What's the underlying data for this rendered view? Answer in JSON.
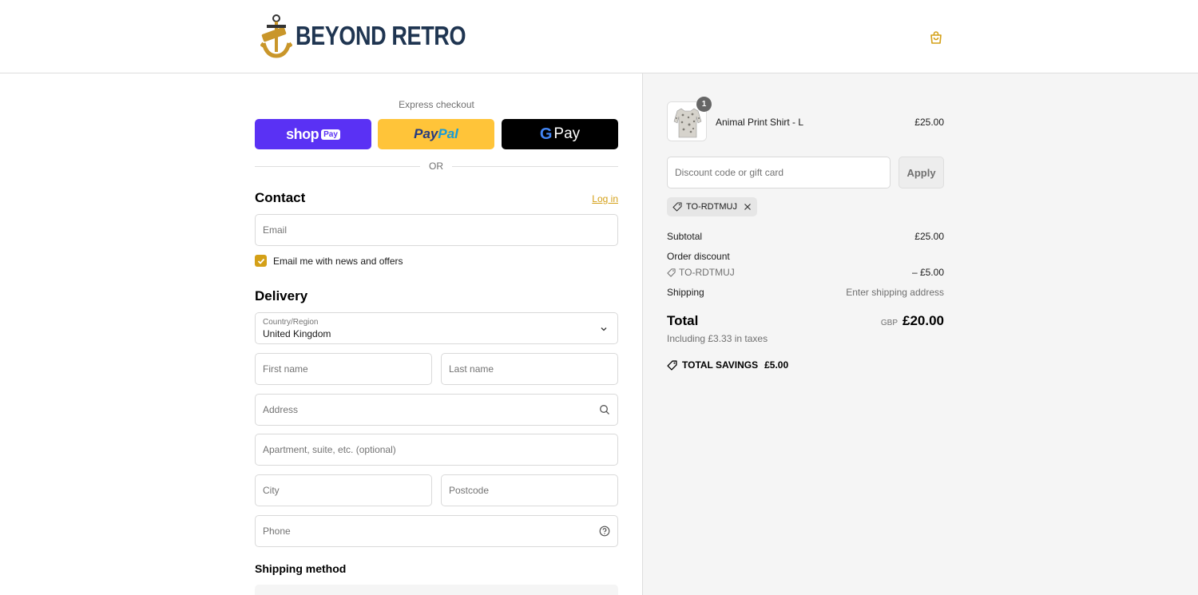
{
  "header": {
    "brand": "BEYOND RETRO"
  },
  "express": {
    "title": "Express checkout",
    "shop_word": "shop",
    "shop_box": "Pay",
    "paypal_a": "Pay",
    "paypal_b": "Pal",
    "gpay_g": "G",
    "gpay_word": "Pay",
    "or": "OR"
  },
  "contact": {
    "heading": "Contact",
    "login": "Log in",
    "email_placeholder": "Email",
    "news_label": "Email me with news and offers",
    "news_checked": true
  },
  "delivery": {
    "heading": "Delivery",
    "country_label": "Country/Region",
    "country_value": "United Kingdom",
    "first_name": "First name",
    "last_name": "Last name",
    "address": "Address",
    "apartment": "Apartment, suite, etc. (optional)",
    "city": "City",
    "postcode": "Postcode",
    "phone": "Phone"
  },
  "shipping": {
    "heading": "Shipping method"
  },
  "summary": {
    "item": {
      "name": "Animal Print Shirt - L",
      "price": "£25.00",
      "qty": "1"
    },
    "discount_placeholder": "Discount code or gift card",
    "apply": "Apply",
    "applied_code": "TO-RDTMUJ",
    "subtotal_label": "Subtotal",
    "subtotal": "£25.00",
    "order_discount_label": "Order discount",
    "discount_code": "TO-RDTMUJ",
    "discount_amount": "– £5.00",
    "shipping_label": "Shipping",
    "shipping_value": "Enter shipping address",
    "total_label": "Total",
    "currency": "GBP",
    "total": "£20.00",
    "tax_note": "Including £3.33 in taxes",
    "savings_label": "TOTAL SAVINGS",
    "savings_value": "£5.00"
  },
  "colors": {
    "accent": "#d4a017",
    "brand_navy": "#1f3551",
    "shop_pay": "#5a31f4",
    "paypal": "#ffc439"
  }
}
